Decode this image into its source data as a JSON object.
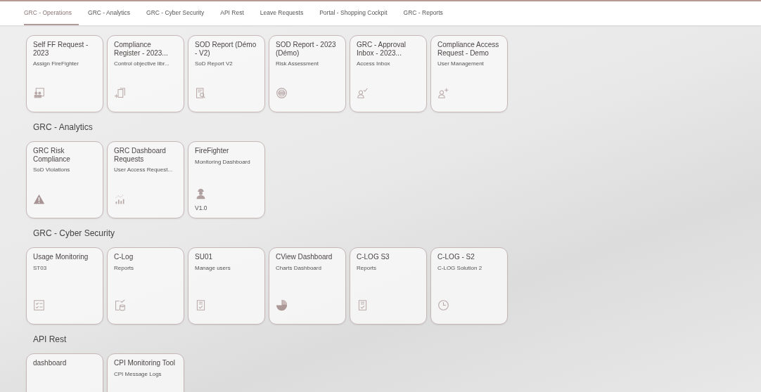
{
  "tabs": [
    {
      "label": "GRC - Operations",
      "selected": true
    },
    {
      "label": "GRC - Analytics",
      "selected": false
    },
    {
      "label": "GRC - Cyber Security",
      "selected": false
    },
    {
      "label": "API Rest",
      "selected": false
    },
    {
      "label": "Leave Requests",
      "selected": false
    },
    {
      "label": "Portal - Shopping Cockpit",
      "selected": false
    },
    {
      "label": "GRC - Reports",
      "selected": false
    }
  ],
  "groups": [
    {
      "tiles": [
        {
          "title": "Self FF Request - 2023",
          "subtitle": "Assign FireFighter",
          "kind": "people"
        },
        {
          "title": "Compliance Register - 2023...",
          "subtitle": "Control objective libr...",
          "kind": "copyadd"
        },
        {
          "title": "SOD Report (Démo - V2)",
          "subtitle": "SoD Report V2",
          "kind": "docsearch"
        },
        {
          "title": "SOD Report - 2023 (Démo)",
          "subtitle": "Risk Assessment",
          "kind": "target"
        },
        {
          "title": "GRC - Approval Inbox - 2023...",
          "subtitle": "Access Inbox",
          "kind": "personcheck"
        },
        {
          "title": "Compliance Access Request - Demo",
          "subtitle": "User Management",
          "kind": "personadd"
        }
      ]
    },
    {
      "title": "GRC - Analytics",
      "tiles": [
        {
          "title": "GRC Risk Compliance",
          "subtitle": "SoD Violations",
          "kind": "warning"
        },
        {
          "title": "GRC Dashboard Requests",
          "subtitle": "User Access Request...",
          "kind": "chart"
        },
        {
          "title": "FireFighter",
          "subtitle": "Monitoring Dashboard",
          "kind": "worker",
          "footer": "V1.0"
        }
      ]
    },
    {
      "title": "GRC - Cyber Security",
      "tiles": [
        {
          "title": "Usage Monitoring",
          "subtitle": "ST03",
          "kind": "checklist"
        },
        {
          "title": "C-Log",
          "subtitle": "Reports",
          "kind": "docdb"
        },
        {
          "title": "SU01",
          "subtitle": "Manage users",
          "kind": "doccheck"
        },
        {
          "title": "CView Dashboard",
          "subtitle": "Charts Dashboard",
          "kind": "pie"
        },
        {
          "title": "C-LOG S3",
          "subtitle": "Reports",
          "kind": "doccheck"
        },
        {
          "title": "C-LOG - S2",
          "subtitle": "C-LOG Solution 2",
          "kind": "clock"
        }
      ]
    },
    {
      "title": "API Rest",
      "tiles": [
        {
          "title": "dashboard"
        },
        {
          "title": "CPI Monitoring Tool",
          "subtitle": "CPI Message Logs"
        }
      ]
    }
  ]
}
